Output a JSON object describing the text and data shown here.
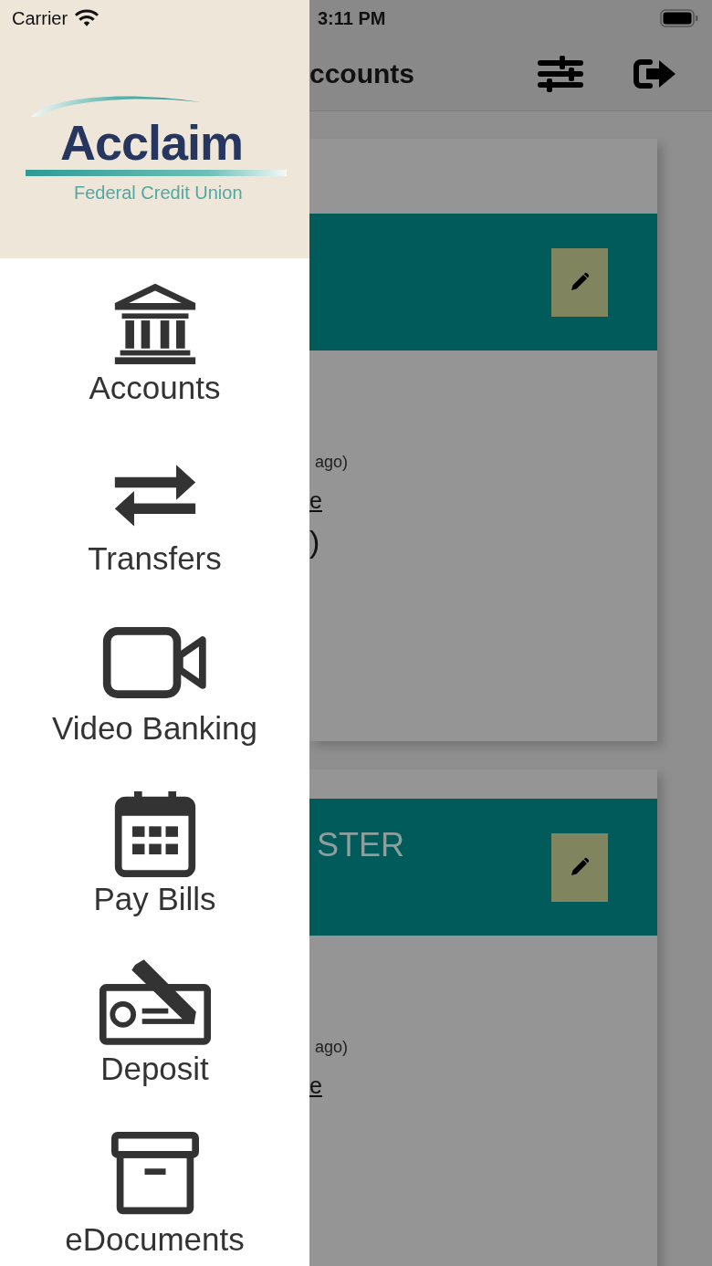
{
  "status_bar": {
    "carrier": "Carrier",
    "time": "3:11 PM"
  },
  "drawer": {
    "logo": {
      "name": "Acclaim",
      "subtitle": "Federal Credit Union"
    },
    "items": [
      {
        "kind": "bank",
        "label": "Accounts"
      },
      {
        "kind": "transfer",
        "label": "Transfers"
      },
      {
        "kind": "video",
        "label": "Video Banking"
      },
      {
        "kind": "calendar",
        "label": "Pay Bills"
      },
      {
        "kind": "check",
        "label": "Deposit"
      },
      {
        "kind": "archive",
        "label": "eDocuments"
      }
    ]
  },
  "background": {
    "title": "ccounts",
    "cards": [
      {
        "lines": [
          {
            "kind": "small",
            "text": "ago)"
          },
          {
            "kind": "link",
            "text": "e"
          },
          {
            "kind": "large",
            "text": ")"
          }
        ]
      },
      {
        "header": "STER",
        "lines": [
          {
            "kind": "small",
            "text": "ago)"
          },
          {
            "kind": "link",
            "text": "e"
          }
        ]
      }
    ]
  }
}
